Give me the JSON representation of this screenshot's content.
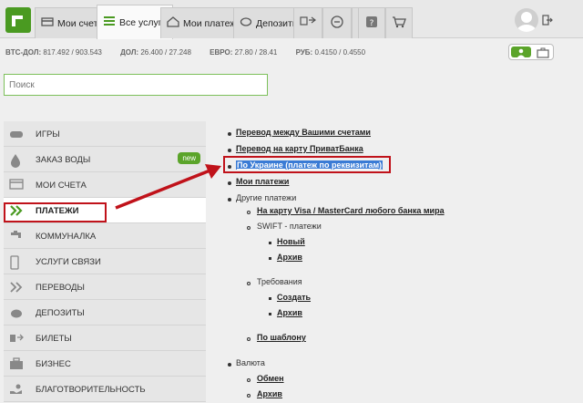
{
  "tabs": [
    {
      "label": "Мои счета",
      "icon": "cards-icon"
    },
    {
      "label": "Все услуги",
      "icon": "list-icon"
    },
    {
      "label": "Мои платежи",
      "icon": "house-icon"
    },
    {
      "label": "Депозиты",
      "icon": "piggy-icon"
    }
  ],
  "rates": {
    "btc_label": "BTC-ДОЛ:",
    "btc_value": "817.492 / 903.543",
    "usd_label": "ДОЛ:",
    "usd_value": "26.400 / 27.248",
    "eur_label": "ЕВРО:",
    "eur_value": "27.80 / 28.41",
    "rub_label": "РУБ:",
    "rub_value": "0.4150 / 0.4550"
  },
  "search": {
    "placeholder": "Поиск"
  },
  "sidebar": {
    "items": [
      {
        "label": "ИГРЫ",
        "icon": "gamepad-icon"
      },
      {
        "label": "ЗАКАЗ ВОДЫ",
        "icon": "water-drop-icon",
        "badge": "new"
      },
      {
        "label": "МОИ СЧЕТА",
        "icon": "card-icon"
      },
      {
        "label": "ПЛАТЕЖИ",
        "icon": "double-chevron-icon"
      },
      {
        "label": "КОММУНАЛКА",
        "icon": "faucet-icon"
      },
      {
        "label": "УСЛУГИ СВЯЗИ",
        "icon": "phone-icon"
      },
      {
        "label": "ПЕРЕВОДЫ",
        "icon": "chevrons-right-icon"
      },
      {
        "label": "ДЕПОЗИТЫ",
        "icon": "piggy-bank-icon"
      },
      {
        "label": "БИЛЕТЫ",
        "icon": "transport-icon"
      },
      {
        "label": "БИЗНЕС",
        "icon": "briefcase-icon"
      },
      {
        "label": "БЛАГОТВОРИТЕЛЬНОСТЬ",
        "icon": "charity-icon"
      }
    ]
  },
  "content": {
    "transfer_own": "Перевод между Вашими счетами",
    "transfer_card": "Перевод на карту ПриватБанка",
    "ukraine": "По Украине (платеж по реквизитам)",
    "my_payments": "Мои платежи",
    "other": "Другие платежи",
    "visa_mc": "На карту Visa / MasterCard любого банка мира",
    "swift": "SWIFT - платежи",
    "swift_new": "Новый",
    "swift_archive": "Архив",
    "requirements": "Требования",
    "req_create": "Создать",
    "req_archive": "Архив",
    "by_template": "По шаблону",
    "currency": "Валюта",
    "exchange": "Обмен",
    "cur_archive": "Архив"
  },
  "colors": {
    "accent": "#5ba42a",
    "highlight": "#c0121a",
    "selection": "#3a7bd5"
  }
}
